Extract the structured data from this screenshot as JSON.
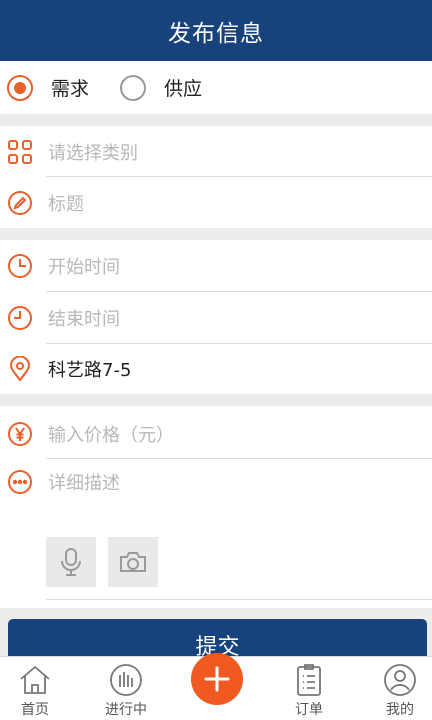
{
  "header": {
    "title": "发布信息"
  },
  "type_select": {
    "options": [
      {
        "label": "需求",
        "selected": true
      },
      {
        "label": "供应",
        "selected": false
      }
    ]
  },
  "form": {
    "category_placeholder": "请选择类别",
    "title_placeholder": "标题",
    "start_time_placeholder": "开始时间",
    "end_time_placeholder": "结束时间",
    "location_value": "科艺路7-5",
    "price_placeholder": "输入价格（元）",
    "description_placeholder": "详细描述"
  },
  "submit_label": "提交",
  "tabbar": {
    "items": [
      {
        "label": "首页",
        "icon": "home-icon"
      },
      {
        "label": "进行中",
        "icon": "in-progress-icon"
      },
      {
        "label": "",
        "icon": "plus-icon"
      },
      {
        "label": "订单",
        "icon": "order-icon"
      },
      {
        "label": "我的",
        "icon": "profile-icon"
      }
    ]
  },
  "colors": {
    "header": "#17427c",
    "accent": "#e8612b",
    "plus": "#f05a22"
  }
}
